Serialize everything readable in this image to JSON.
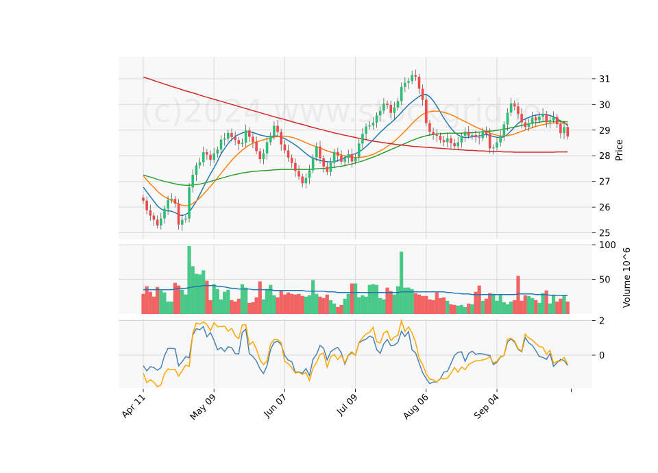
{
  "watermark": "(c)2024 www.stockgrid.io",
  "chart_data": {
    "type": "candlestick",
    "start_date": "2024-04-11",
    "x_tick_labels": [
      "Apr 11",
      "May 09",
      "Jun 07",
      "Jul 09",
      "Aug 06",
      "Sep 04"
    ],
    "x_tick_indices": [
      0,
      20,
      40,
      60,
      80,
      100
    ],
    "x_count": 121,
    "price_panel": {
      "ylabel": "Price",
      "yticks": [
        25,
        26,
        27,
        28,
        29,
        30,
        31
      ],
      "ylim": [
        24.75,
        31.85
      ],
      "closes": [
        26.25,
        25.88,
        25.67,
        25.51,
        25.29,
        25.56,
        25.94,
        26.27,
        26.32,
        26.14,
        25.32,
        25.51,
        25.56,
        26.77,
        27.26,
        27.62,
        27.75,
        28.14,
        28.04,
        27.84,
        28.09,
        28.24,
        28.63,
        28.67,
        28.89,
        28.73,
        28.61,
        28.46,
        28.51,
        28.99,
        28.74,
        28.53,
        28.18,
        27.87,
        28.09,
        28.53,
        28.79,
        29.17,
        28.93,
        28.44,
        28.21,
        27.93,
        27.72,
        27.41,
        27.19,
        26.93,
        27.14,
        27.43,
        27.94,
        28.36,
        27.9,
        27.58,
        27.37,
        27.72,
        28.15,
        28.0,
        27.77,
        27.9,
        28.06,
        27.78,
        27.95,
        28.48,
        28.85,
        29.14,
        29.18,
        29.29,
        29.57,
        29.75,
        30.03,
        29.98,
        29.67,
        29.88,
        30.13,
        30.68,
        30.84,
        30.91,
        31.14,
        31.08,
        30.61,
        30.18,
        29.27,
        28.93,
        28.82,
        28.78,
        28.61,
        28.53,
        28.68,
        28.49,
        28.37,
        28.52,
        28.78,
        28.94,
        28.78,
        28.81,
        28.72,
        28.69,
        28.97,
        28.86,
        28.29,
        28.32,
        28.52,
        28.77,
        29.22,
        29.68,
        30.04,
        29.92,
        29.63,
        29.3,
        29.12,
        29.27,
        29.49,
        29.38,
        29.52,
        29.63,
        29.3,
        29.39,
        29.51,
        29.23,
        28.88,
        29.12,
        28.75
      ],
      "series": [
        {
          "name": "",
          "color": "#1f77b4",
          "values": [
            26.78,
            26.59,
            26.41,
            26.23,
            26.05,
            25.93,
            25.86,
            25.86,
            25.84,
            25.79,
            25.71,
            25.67,
            25.71,
            25.81,
            26.01,
            26.23,
            26.5,
            26.77,
            27.04,
            27.29,
            27.53,
            27.79,
            28.08,
            28.28,
            28.48,
            28.63,
            28.75,
            28.83,
            28.89,
            28.93,
            28.93,
            28.91,
            28.86,
            28.81,
            28.78,
            28.75,
            28.75,
            28.77,
            28.77,
            28.72,
            28.67,
            28.59,
            28.51,
            28.42,
            28.32,
            28.2,
            28.09,
            27.98,
            27.91,
            27.86,
            27.82,
            27.79,
            27.77,
            27.76,
            27.77,
            27.81,
            27.87,
            27.93,
            27.99,
            28.04,
            28.08,
            28.15,
            28.24,
            28.36,
            28.49,
            28.62,
            28.77,
            28.91,
            29.04,
            29.17,
            29.28,
            29.41,
            29.54,
            29.69,
            29.84,
            29.98,
            30.1,
            30.21,
            30.31,
            30.38,
            30.39,
            30.3,
            30.14,
            29.93,
            29.7,
            29.46,
            29.26,
            29.07,
            28.92,
            28.81,
            28.74,
            28.71,
            28.72,
            28.74,
            28.76,
            28.77,
            28.8,
            28.83,
            28.79,
            28.75,
            28.72,
            28.71,
            28.74,
            28.83,
            28.97,
            29.12,
            29.26,
            29.37,
            29.44,
            29.49,
            29.55,
            29.58,
            29.6,
            29.62,
            29.6,
            29.57,
            29.52,
            29.44,
            29.35,
            29.29,
            29.18
          ]
        },
        {
          "name": "",
          "color": "#ff7f0e",
          "values": [
            27.22,
            27.06,
            26.91,
            26.77,
            26.62,
            26.5,
            26.4,
            26.33,
            26.26,
            26.2,
            26.12,
            26.07,
            26.05,
            26.07,
            26.14,
            26.24,
            26.36,
            26.5,
            26.65,
            26.81,
            26.97,
            27.14,
            27.32,
            27.49,
            27.66,
            27.82,
            27.97,
            28.1,
            28.22,
            28.33,
            28.42,
            28.49,
            28.54,
            28.58,
            28.62,
            28.66,
            28.7,
            28.73,
            28.75,
            28.76,
            28.76,
            28.75,
            28.72,
            28.68,
            28.63,
            28.57,
            28.51,
            28.45,
            28.4,
            28.35,
            28.3,
            28.24,
            28.19,
            28.15,
            28.11,
            28.07,
            28.03,
            28.0,
            27.97,
            27.95,
            27.93,
            27.93,
            27.95,
            27.97,
            28.01,
            28.06,
            28.12,
            28.19,
            28.27,
            28.36,
            28.46,
            28.57,
            28.69,
            28.82,
            28.96,
            29.1,
            29.25,
            29.39,
            29.51,
            29.61,
            29.68,
            29.72,
            29.74,
            29.74,
            29.72,
            29.69,
            29.65,
            29.6,
            29.54,
            29.47,
            29.4,
            29.33,
            29.26,
            29.19,
            29.12,
            29.06,
            29.0,
            28.95,
            28.89,
            28.84,
            28.8,
            28.77,
            28.76,
            28.78,
            28.81,
            28.85,
            28.9,
            28.95,
            29.0,
            29.05,
            29.1,
            29.14,
            29.18,
            29.21,
            29.24,
            29.26,
            29.28,
            29.28,
            29.27,
            29.27,
            29.25
          ]
        },
        {
          "name": "",
          "color": "#2ca02c",
          "values": [
            27.25,
            27.21,
            27.17,
            27.13,
            27.08,
            27.04,
            27.0,
            26.97,
            26.94,
            26.91,
            26.88,
            26.86,
            26.85,
            26.85,
            26.86,
            26.88,
            26.9,
            26.93,
            26.96,
            27.0,
            27.04,
            27.08,
            27.12,
            27.16,
            27.2,
            27.24,
            27.27,
            27.3,
            27.33,
            27.35,
            27.37,
            27.39,
            27.4,
            27.41,
            27.42,
            27.43,
            27.44,
            27.45,
            27.46,
            27.47,
            27.47,
            27.47,
            27.47,
            27.47,
            27.47,
            27.47,
            27.47,
            27.47,
            27.48,
            27.49,
            27.5,
            27.51,
            27.52,
            27.53,
            27.55,
            27.57,
            27.59,
            27.62,
            27.65,
            27.68,
            27.72,
            27.76,
            27.8,
            27.85,
            27.9,
            27.95,
            28.0,
            28.06,
            28.12,
            28.18,
            28.24,
            28.3,
            28.36,
            28.42,
            28.48,
            28.54,
            28.6,
            28.65,
            28.7,
            28.74,
            28.78,
            28.81,
            28.83,
            28.85,
            28.86,
            28.87,
            28.88,
            28.88,
            28.88,
            28.88,
            28.88,
            28.89,
            28.89,
            28.9,
            28.91,
            28.92,
            28.93,
            28.95,
            28.96,
            28.97,
            28.99,
            29.01,
            29.03,
            29.06,
            29.09,
            29.12,
            29.15,
            29.18,
            29.21,
            29.24,
            29.27,
            29.29,
            29.31,
            29.33,
            29.34,
            29.35,
            29.35,
            29.35,
            29.34,
            29.33,
            29.32
          ]
        },
        {
          "name": "",
          "color": "#d62728",
          "values": [
            31.07,
            31.02,
            30.98,
            30.93,
            30.88,
            30.84,
            30.79,
            30.75,
            30.7,
            30.66,
            30.62,
            30.57,
            30.53,
            30.49,
            30.45,
            30.41,
            30.36,
            30.32,
            30.28,
            30.24,
            30.2,
            30.16,
            30.12,
            30.08,
            30.04,
            30.0,
            29.96,
            29.92,
            29.88,
            29.84,
            29.8,
            29.76,
            29.72,
            29.68,
            29.64,
            29.6,
            29.56,
            29.52,
            29.48,
            29.45,
            29.41,
            29.37,
            29.33,
            29.29,
            29.25,
            29.22,
            29.18,
            29.14,
            29.1,
            29.07,
            29.03,
            29.0,
            28.96,
            28.93,
            28.89,
            28.86,
            28.83,
            28.8,
            28.77,
            28.74,
            28.71,
            28.68,
            28.65,
            28.63,
            28.6,
            28.57,
            28.55,
            28.53,
            28.51,
            28.49,
            28.47,
            28.45,
            28.43,
            28.42,
            28.4,
            28.39,
            28.37,
            28.36,
            28.35,
            28.34,
            28.33,
            28.32,
            28.31,
            28.3,
            28.29,
            28.28,
            28.27,
            28.26,
            28.25,
            28.24,
            28.23,
            28.22,
            28.21,
            28.21,
            28.2,
            28.19,
            28.19,
            28.18,
            28.17,
            28.17,
            28.16,
            28.16,
            28.15,
            28.15,
            28.15,
            28.14,
            28.14,
            28.14,
            28.14,
            28.14,
            28.14,
            28.14,
            28.14,
            28.14,
            28.14,
            28.14,
            28.14,
            28.15,
            28.15,
            28.15,
            28.15
          ]
        }
      ]
    },
    "volume_panel": {
      "ylabel": "Volume  10^6",
      "yticks": [
        50,
        100
      ],
      "ylim": [
        0,
        100
      ],
      "values": [
        29,
        40,
        32,
        25,
        39,
        34,
        31,
        18,
        18,
        45,
        41,
        35,
        28,
        98,
        69,
        58,
        57,
        63,
        48,
        20,
        43,
        36,
        21,
        32,
        35,
        20,
        18,
        22,
        43,
        38,
        16,
        17,
        24,
        47,
        21,
        36,
        42,
        27,
        24,
        33,
        28,
        31,
        29,
        28,
        29,
        26,
        25,
        27,
        49,
        29,
        25,
        23,
        28,
        20,
        15,
        10,
        13,
        22,
        29,
        44,
        44,
        24,
        27,
        25,
        42,
        43,
        42,
        23,
        21,
        38,
        33,
        28,
        40,
        90,
        38,
        38,
        36,
        30,
        28,
        26,
        26,
        21,
        20,
        31,
        23,
        24,
        19,
        14,
        13,
        12,
        13,
        10,
        15,
        14,
        32,
        41,
        19,
        22,
        30,
        29,
        19,
        27,
        17,
        14,
        18,
        20,
        55,
        19,
        27,
        26,
        23,
        20,
        16,
        30,
        34,
        15,
        28,
        18,
        22,
        27,
        18
      ],
      "moving_average": [
        35,
        35,
        35,
        35,
        35,
        35,
        35,
        35,
        35,
        36,
        37,
        37,
        37,
        38,
        39,
        40,
        40,
        41,
        41,
        41,
        41,
        40,
        40,
        39,
        38,
        37,
        37,
        36,
        36,
        36,
        36,
        35,
        35,
        35,
        35,
        35,
        35,
        34,
        34,
        34,
        34,
        34,
        34,
        34,
        34,
        34,
        33,
        33,
        33,
        33,
        33,
        33,
        32,
        32,
        32,
        31,
        31,
        31,
        31,
        31,
        31,
        31,
        31,
        31,
        31,
        31,
        31,
        31,
        31,
        31,
        31,
        31,
        31,
        32,
        32,
        32,
        32,
        32,
        32,
        32,
        32,
        32,
        32,
        32,
        32,
        32,
        31,
        31,
        30,
        30,
        29,
        29,
        29,
        28,
        28,
        28,
        28,
        28,
        28,
        28,
        28,
        28,
        28,
        28,
        28,
        28,
        29,
        29,
        29,
        29,
        29,
        28,
        28,
        28,
        28,
        27,
        27,
        27,
        27,
        27,
        27
      ]
    },
    "oscillator_panel": {
      "yticks": [
        0,
        2
      ],
      "ylim": [
        -1.9,
        2.1
      ],
      "series": [
        {
          "name": "",
          "color": "#4682b4",
          "values": [
            -0.61,
            -0.91,
            -0.67,
            -0.72,
            -0.87,
            -0.74,
            -0.03,
            0.38,
            0.39,
            0.37,
            -0.62,
            -0.38,
            -0.09,
            -0.15,
            1.17,
            1.52,
            1.47,
            1.65,
            1.06,
            1.3,
            0.86,
            0.31,
            0.44,
            0.21,
            0.48,
            0.43,
            0.09,
            0.07,
            1.31,
            1.5,
            0.08,
            -0.08,
            -0.34,
            -0.79,
            -1.07,
            -0.61,
            0.33,
            0.73,
            0.8,
            0.61,
            -0.02,
            -0.3,
            -0.38,
            -1.0,
            -0.97,
            -1.05,
            -0.78,
            -1.17,
            -0.24,
            0.04,
            0.56,
            0.39,
            -0.28,
            0.19,
            0.34,
            0.45,
            0.13,
            -0.52,
            -0.01,
            0.14,
            0.0,
            0.71,
            0.84,
            0.92,
            1.1,
            1.01,
            0.32,
            0.1,
            0.65,
            0.9,
            0.54,
            0.58,
            0.73,
            1.38,
            1.08,
            1.36,
            0.31,
            0.12,
            -0.45,
            -1.01,
            -1.36,
            -1.65,
            -1.55,
            -1.56,
            -1.37,
            -0.98,
            -0.94,
            -0.5,
            -0.02,
            0.16,
            0.19,
            -0.36,
            0.09,
            0.23,
            0.05,
            0.09,
            0.07,
            0.01,
            -0.02,
            -0.55,
            -0.41,
            -0.11,
            -0.03,
            0.77,
            0.93,
            0.75,
            0.33,
            0.2,
            1.02,
            0.71,
            0.56,
            0.26,
            -0.09,
            -0.13,
            -0.25,
            0.09,
            -0.65,
            -0.44,
            -0.24,
            -0.32,
            -0.59
          ]
        },
        {
          "name": "",
          "color": "#ffa500",
          "values": [
            -1.05,
            -1.59,
            -1.43,
            -1.56,
            -1.83,
            -1.72,
            -1.07,
            -0.8,
            -0.84,
            -0.83,
            -1.21,
            -0.9,
            -0.58,
            -0.65,
            1.25,
            1.86,
            1.79,
            1.92,
            1.77,
            1.41,
            1.87,
            1.64,
            1.65,
            1.67,
            1.38,
            1.55,
            1.11,
            0.96,
            1.74,
            1.75,
            0.6,
            0.77,
            0.35,
            -0.27,
            -0.55,
            -0.33,
            0.64,
            0.9,
            0.89,
            0.72,
            -0.36,
            -0.5,
            -0.73,
            -1.04,
            -0.99,
            -1.11,
            -1.0,
            -1.47,
            -0.74,
            -0.43,
            0.04,
            0.11,
            -0.7,
            -0.1,
            0.03,
            -0.25,
            -0.01,
            -0.45,
            0.02,
            0.19,
            -0.02,
            0.74,
            0.99,
            1.22,
            1.32,
            1.61,
            0.77,
            0.7,
            1.28,
            1.39,
            0.85,
            1.04,
            1.14,
            1.98,
            1.37,
            1.63,
            1.28,
            0.75,
            -0.18,
            -0.53,
            -1.09,
            -1.38,
            -1.43,
            -1.55,
            -1.34,
            -1.38,
            -1.33,
            -1.05,
            -0.72,
            -0.98,
            -0.68,
            -0.84,
            -0.54,
            -0.43,
            -0.33,
            -0.33,
            -0.27,
            -0.22,
            -0.09,
            -0.46,
            -0.36,
            -0.08,
            -0.04,
            0.91,
            0.97,
            0.81,
            0.37,
            0.24,
            1.22,
            0.99,
            0.87,
            0.67,
            0.49,
            0.45,
            0.04,
            0.28,
            -0.48,
            -0.35,
            -0.34,
            -0.14,
            -0.53
          ]
        }
      ]
    }
  }
}
